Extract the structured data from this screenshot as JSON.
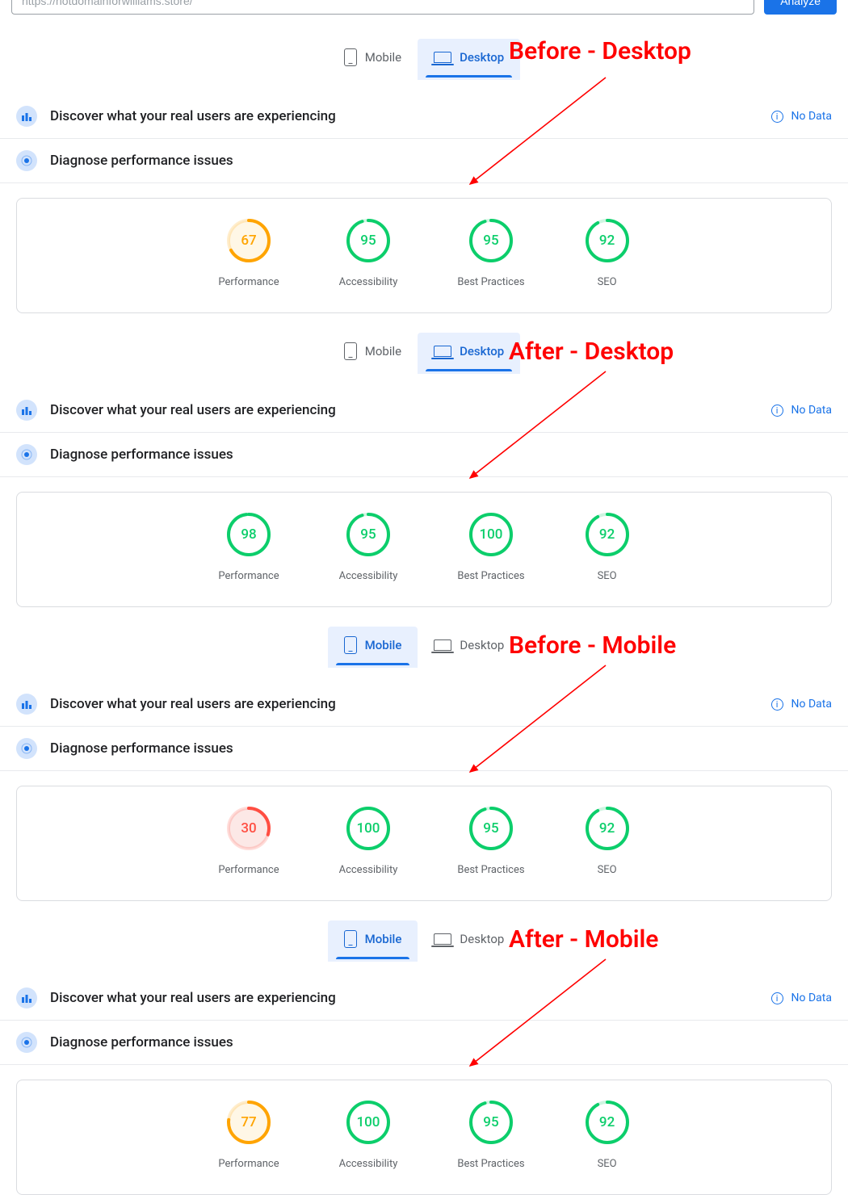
{
  "topbar": {
    "url_value": "https://hotdomainforwilliams.store/",
    "analyze_label": "Analyze"
  },
  "tabs": {
    "mobile": "Mobile",
    "desktop": "Desktop"
  },
  "section": {
    "discover": "Discover what your real users are experiencing",
    "diagnose": "Diagnose performance issues",
    "nodata": "No Data"
  },
  "metrics": {
    "performance": "Performance",
    "accessibility": "Accessibility",
    "best_practices": "Best Practices",
    "seo": "SEO"
  },
  "annot": {
    "b_desk": "Before - Desktop",
    "a_desk": "After - Desktop",
    "b_mob": "Before - Mobile",
    "a_mob": "After - Mobile"
  },
  "colors": {
    "green": "#0cce6b",
    "orange": "#ffa400",
    "red": "#ff4e42"
  },
  "blocks": [
    {
      "active": "desktop",
      "annot": "b_desk",
      "scores": {
        "performance": 67,
        "accessibility": 95,
        "best_practices": 95,
        "seo": 92
      },
      "grades": {
        "performance": "orange",
        "accessibility": "green",
        "best_practices": "green",
        "seo": "green"
      }
    },
    {
      "active": "desktop",
      "annot": "a_desk",
      "scores": {
        "performance": 98,
        "accessibility": 95,
        "best_practices": 100,
        "seo": 92
      },
      "grades": {
        "performance": "green",
        "accessibility": "green",
        "best_practices": "green",
        "seo": "green"
      }
    },
    {
      "active": "mobile",
      "annot": "b_mob",
      "scores": {
        "performance": 30,
        "accessibility": 100,
        "best_practices": 95,
        "seo": 92
      },
      "grades": {
        "performance": "red",
        "accessibility": "green",
        "best_practices": "green",
        "seo": "green"
      }
    },
    {
      "active": "mobile",
      "annot": "a_mob",
      "scores": {
        "performance": 77,
        "accessibility": 100,
        "best_practices": 95,
        "seo": 92
      },
      "grades": {
        "performance": "orange",
        "accessibility": "green",
        "best_practices": "green",
        "seo": "green"
      }
    }
  ],
  "chart_data": [
    {
      "type": "bar",
      "title": "Before - Desktop",
      "categories": [
        "Performance",
        "Accessibility",
        "Best Practices",
        "SEO"
      ],
      "values": [
        67,
        95,
        95,
        92
      ],
      "ylim": [
        0,
        100
      ]
    },
    {
      "type": "bar",
      "title": "After - Desktop",
      "categories": [
        "Performance",
        "Accessibility",
        "Best Practices",
        "SEO"
      ],
      "values": [
        98,
        95,
        100,
        92
      ],
      "ylim": [
        0,
        100
      ]
    },
    {
      "type": "bar",
      "title": "Before - Mobile",
      "categories": [
        "Performance",
        "Accessibility",
        "Best Practices",
        "SEO"
      ],
      "values": [
        30,
        100,
        95,
        92
      ],
      "ylim": [
        0,
        100
      ]
    },
    {
      "type": "bar",
      "title": "After - Mobile",
      "categories": [
        "Performance",
        "Accessibility",
        "Best Practices",
        "SEO"
      ],
      "values": [
        77,
        100,
        95,
        92
      ],
      "ylim": [
        0,
        100
      ]
    }
  ]
}
